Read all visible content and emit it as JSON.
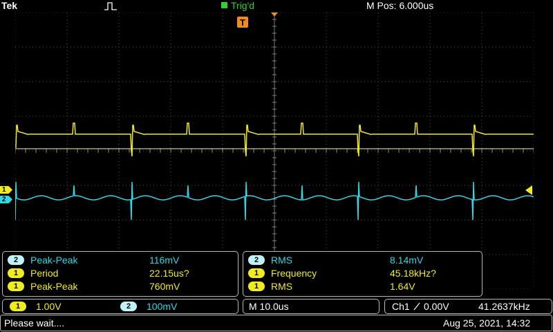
{
  "header": {
    "brand": "Tek",
    "trigger_state": "Trig'd",
    "horizontal_position": "M Pos: 6.000us"
  },
  "markers": {
    "ch1": "1",
    "ch2": "2",
    "trigger_marker": "T"
  },
  "measurements": {
    "left": [
      {
        "ch": "2",
        "name": "Peak-Peak",
        "value": "116mV"
      },
      {
        "ch": "1",
        "name": "Period",
        "value": "22.15us?"
      },
      {
        "ch": "1",
        "name": "Peak-Peak",
        "value": "760mV"
      }
    ],
    "right": [
      {
        "ch": "2",
        "name": "RMS",
        "value": "8.14mV"
      },
      {
        "ch": "1",
        "name": "Frequency",
        "value": "45.18kHz?"
      },
      {
        "ch": "1",
        "name": "RMS",
        "value": "1.64V"
      }
    ]
  },
  "channels": {
    "ch1_label": "1",
    "ch1_scale": "1.00V",
    "ch2_label": "2",
    "ch2_scale": "100mV"
  },
  "timebase": "M 10.0us",
  "trigger": {
    "source": "Ch1",
    "level": "0.00V",
    "frequency": "41.2637kHz"
  },
  "status": {
    "message": "Please wait....",
    "datetime": "Aug 25, 2021, 14:32"
  },
  "colors": {
    "ch1": "#f0ec1e",
    "ch2": "#34d6e6",
    "trigger": "#f08c1e",
    "trig_state": "#2fd12f"
  }
}
